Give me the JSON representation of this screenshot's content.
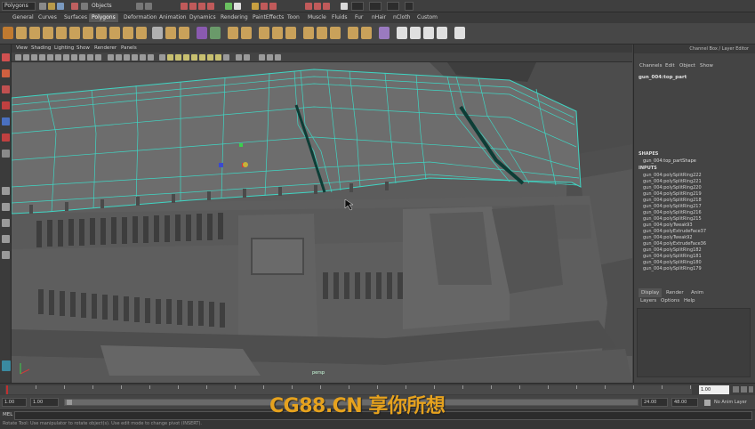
{
  "status_line": {
    "mode": "Polygons",
    "objects_label": "Objects"
  },
  "shelf_tabs": [
    "General",
    "Curves",
    "Surfaces",
    "Polygons",
    "Deformation",
    "Animation",
    "Dynamics",
    "Rendering",
    "PaintEffects",
    "Toon",
    "Muscle",
    "Fluids",
    "Fur",
    "nHair",
    "nCloth",
    "Custom"
  ],
  "shelf_active_tab": "Polygons",
  "viewport": {
    "menu": [
      "View",
      "Shading",
      "Lighting",
      "Show",
      "Renderer",
      "Panels"
    ],
    "camera_label": "persp"
  },
  "channel_box": {
    "title": "Channel Box / Layer Editor",
    "menu": [
      "Channels",
      "Edit",
      "Object",
      "Show"
    ],
    "node_name": "gun_004:top_part",
    "shapes_header": "SHAPES",
    "shape_name": "gun_004:top_partShape",
    "inputs_header": "INPUTS",
    "inputs": [
      "gun_004:polySplitRing222",
      "gun_004:polySplitRing221",
      "gun_004:polySplitRing220",
      "gun_004:polySplitRing219",
      "gun_004:polySplitRing218",
      "gun_004:polySplitRing217",
      "gun_004:polySplitRing216",
      "gun_004:polySplitRing215",
      "gun_004:polyTweak93",
      "gun_004:polyExtrudeFace37",
      "gun_004:polyTweak92",
      "gun_004:polyExtrudeFace36",
      "gun_004:polySplitRing182",
      "gun_004:polySplitRing181",
      "gun_004:polySplitRing180",
      "gun_004:polySplitRing179"
    ]
  },
  "layer_editor": {
    "tabs": [
      "Display",
      "Render",
      "Anim"
    ],
    "menu": [
      "Layers",
      "Options",
      "Help"
    ]
  },
  "time_slider": {
    "current_time": "1.00"
  },
  "range_slider": {
    "start_time": "1.00",
    "playback_start": "1.00",
    "playback_end": "24.00",
    "end_time": "48.00",
    "anim_layer": "No Anim Layer"
  },
  "command_line": {
    "label": "MEL"
  },
  "help_line": {
    "text": "Rotate Tool: Use manipulator to rotate object(s). Use edit mode to change pivot (INSERT)."
  },
  "watermark": "CG88.CN 享你所想",
  "colors": {
    "wire": "#3fd6c4",
    "mesh": "#6a6a6a",
    "watermark": "#e6a21e"
  }
}
